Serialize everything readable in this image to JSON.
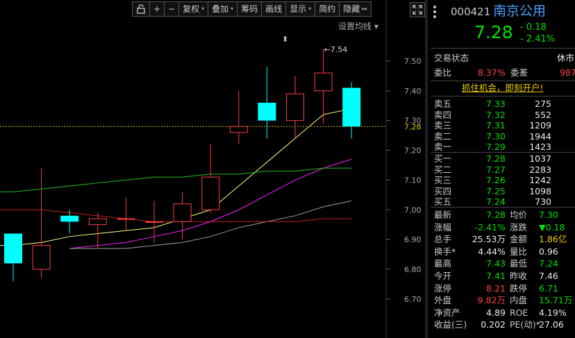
{
  "toolbar": {
    "buttons": [
      {
        "label": "+"
      },
      {
        "label": "−"
      },
      {
        "label": "复权",
        "caret": "▾"
      },
      {
        "label": "叠加",
        "caret": "▾"
      },
      {
        "label": "筹码"
      },
      {
        "label": "画线"
      },
      {
        "label": "显示",
        "caret": "▾"
      },
      {
        "label": "简约"
      },
      {
        "label": "隐藏",
        "caret": "▸▸"
      }
    ],
    "ma_settings": "设置均线 ▾"
  },
  "chart_data": {
    "type": "candlestick",
    "price_axis": {
      "ticks": [
        "7.50",
        "7.40",
        "7.30",
        "7.20",
        "7.10",
        "7.00",
        "6.90",
        "6.80",
        "6.70"
      ],
      "current_label": "7.28"
    },
    "annotation_max": "←7.54",
    "candles": [
      {
        "o": 6.92,
        "c": 6.82,
        "h": 6.92,
        "l": 6.76
      },
      {
        "o": 6.8,
        "c": 6.88,
        "h": 7.14,
        "l": 6.77
      },
      {
        "o": 6.98,
        "c": 6.96,
        "h": 7.0,
        "l": 6.92
      },
      {
        "o": 6.95,
        "c": 6.97,
        "h": 6.99,
        "l": 6.87
      },
      {
        "o": 6.97,
        "c": 6.97,
        "h": 7.04,
        "l": 6.93
      },
      {
        "o": 6.96,
        "c": 6.96,
        "h": 7.03,
        "l": 6.89
      },
      {
        "o": 6.96,
        "c": 7.02,
        "h": 7.06,
        "l": 6.9
      },
      {
        "o": 7.0,
        "c": 7.11,
        "h": 7.22,
        "l": 6.99
      },
      {
        "o": 7.26,
        "c": 7.28,
        "h": 7.4,
        "l": 7.22
      },
      {
        "o": 7.36,
        "c": 7.3,
        "h": 7.48,
        "l": 7.24
      },
      {
        "o": 7.3,
        "c": 7.39,
        "h": 7.45,
        "l": 7.24
      },
      {
        "o": 7.4,
        "c": 7.46,
        "h": 7.54,
        "l": 7.29
      },
      {
        "o": 7.41,
        "c": 7.28,
        "h": 7.43,
        "l": 7.24
      }
    ],
    "ma_lines": [
      {
        "color": "#ffff80",
        "values": [
          6.88,
          6.89,
          6.91,
          6.92,
          6.93,
          6.94,
          6.97,
          7.0,
          7.08,
          7.16,
          7.24,
          7.32,
          7.34
        ]
      },
      {
        "color": "#ff20ff",
        "values": [
          null,
          null,
          6.87,
          6.88,
          6.89,
          6.91,
          6.93,
          6.96,
          7.0,
          7.05,
          7.1,
          7.14,
          7.17
        ]
      },
      {
        "color": "#a0a0a0",
        "values": [
          null,
          null,
          6.87,
          6.87,
          6.87,
          6.88,
          6.89,
          6.91,
          6.94,
          6.96,
          6.98,
          7.01,
          7.03
        ]
      },
      {
        "color": "#20c020",
        "values": [
          7.06,
          7.07,
          7.08,
          7.09,
          7.1,
          7.11,
          7.11,
          7.12,
          7.12,
          7.13,
          7.13,
          7.14,
          7.14
        ]
      },
      {
        "color": "#c02020",
        "values": [
          7.0,
          7.0,
          6.99,
          6.98,
          6.97,
          6.96,
          6.96,
          6.96,
          6.96,
          6.96,
          6.96,
          6.97,
          6.97
        ]
      }
    ]
  },
  "quote": {
    "code": "000421",
    "name": "南京公用",
    "price": "7.28",
    "change": "- 0.18",
    "change_pct": "- 2.41%",
    "trade_status_label": "交易状态",
    "trade_status": "休市",
    "weibi_label": "委比",
    "weibi": "8.37%",
    "weicha_label": "委差",
    "weicha": "987",
    "promo": "抓住机会，即刻开户!",
    "asks": [
      {
        "label": "卖五",
        "price": "7.33",
        "vol": "275"
      },
      {
        "label": "卖四",
        "price": "7.32",
        "vol": "552"
      },
      {
        "label": "卖三",
        "price": "7.31",
        "vol": "1209"
      },
      {
        "label": "卖二",
        "price": "7.30",
        "vol": "1944"
      },
      {
        "label": "卖一",
        "price": "7.29",
        "vol": "1423"
      }
    ],
    "bids": [
      {
        "label": "买一",
        "price": "7.28",
        "vol": "1037"
      },
      {
        "label": "买二",
        "price": "7.27",
        "vol": "2283"
      },
      {
        "label": "买三",
        "price": "7.26",
        "vol": "1242"
      },
      {
        "label": "买四",
        "price": "7.25",
        "vol": "1098"
      },
      {
        "label": "买五",
        "price": "7.24",
        "vol": "730"
      }
    ],
    "stats": [
      {
        "l1": "最新",
        "v1": "7.28",
        "c1": "grn",
        "l2": "均价",
        "v2": "7.30",
        "c2": "grn"
      },
      {
        "l1": "涨幅",
        "v1": "-2.41%",
        "c1": "grn",
        "l2": "涨跌",
        "v2": "▼0.18",
        "c2": "grn"
      },
      {
        "l1": "总手",
        "v1": "25.53万",
        "c1": "wht",
        "l2": "金额",
        "v2": "1.86亿",
        "c2": "yel"
      },
      {
        "l1": "换手*",
        "v1": "4.44%",
        "c1": "wht",
        "l2": "量比",
        "v2": "0.96",
        "c2": "wht"
      },
      {
        "l1": "最高",
        "v1": "7.43",
        "c1": "grn",
        "l2": "最低",
        "v2": "7.24",
        "c2": "grn"
      },
      {
        "l1": "今开",
        "v1": "7.41",
        "c1": "grn",
        "l2": "昨收",
        "v2": "7.46",
        "c2": "wht"
      },
      {
        "l1": "涨停",
        "v1": "8.21",
        "c1": "red",
        "l2": "跌停",
        "v2": "6.71",
        "c2": "grn"
      },
      {
        "l1": "外盘",
        "v1": "9.82万",
        "c1": "red",
        "l2": "内盘",
        "v2": "15.71万",
        "c2": "grn"
      },
      {
        "l1": "净资产",
        "v1": "4.89",
        "c1": "wht",
        "l2": "ROE",
        "v2": "4.19%",
        "c2": "wht"
      },
      {
        "l1": "收益(三)",
        "v1": "0.202",
        "c1": "wht",
        "l2": "PE(动)*",
        "v2": "27.06",
        "c2": "wht"
      }
    ]
  }
}
